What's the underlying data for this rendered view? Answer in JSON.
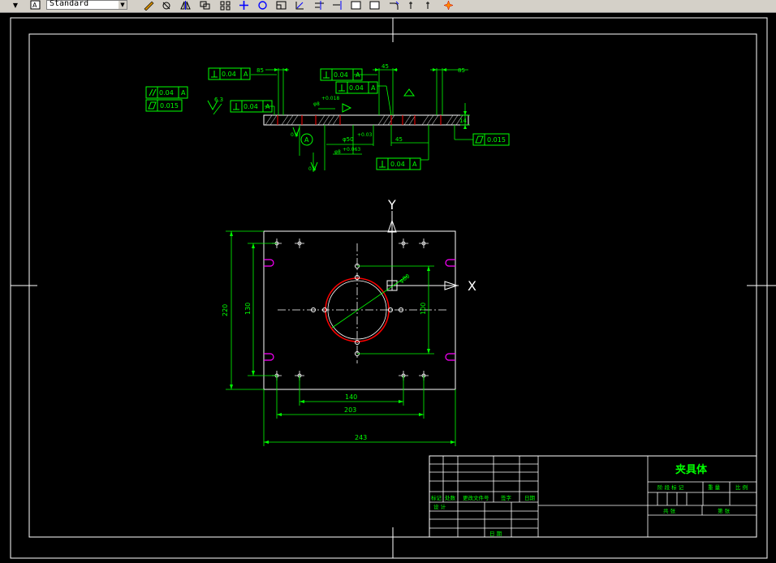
{
  "toolbar": {
    "text_style": "Standard",
    "icons": [
      "dropdown-arrow-icon",
      "text-style-icon",
      "pencil-icon",
      "erase-icon",
      "mirror-icon",
      "copy-icon",
      "array-icon",
      "move-icon",
      "rotate-icon",
      "scale-icon",
      "stretch-icon",
      "trim-icon",
      "extend-icon",
      "break-icon",
      "chamfer-icon",
      "fillet-icon",
      "explode-icon"
    ]
  },
  "drawing": {
    "section_view": {
      "perp_01": "0.04",
      "perp_01_datum": "A",
      "dim_top_1": "85",
      "perp_02": "0.04",
      "perp_02_datum": "A",
      "dim_top_2": "45",
      "dim_top_3": "85",
      "perp_03": "0.04",
      "perp_03_datum": "A",
      "parallel_tol": "0.04",
      "parallel_datum": "A",
      "flatness_tol_1": "0.015",
      "roughness_1": "6.3",
      "perp_04": "0.04",
      "perp_04_datum": "A",
      "dim_hole_1": "φ8",
      "dim_tol_1": "+0.018",
      "dim_thickness": "14",
      "flatness_tol_2": "0.015",
      "dim_left_1": "0.8",
      "datum_label": "A",
      "dim_center": "φ50",
      "dim_center_tol": "+0.03",
      "dim_bottom_1": "45",
      "dim_bottom_2": "φ8",
      "dim_bottom_tol": "+0.063",
      "roughness_2": "0.8",
      "perp_05": "0.04",
      "perp_05_datum": "A"
    },
    "plan_view": {
      "axis_y": "Y",
      "axis_x": "X",
      "dim_height_outer": "220",
      "dim_height_inner": "130",
      "dim_height_center": "100",
      "dim_diameter": "φ80",
      "dim_width_1": "140",
      "dim_width_2": "203",
      "dim_width_total": "243"
    },
    "title_block": {
      "part_name": "夹具体",
      "col_labels": [
        "标记",
        "处数",
        "更改文件号",
        "签字",
        "日期"
      ],
      "design_label": "设 计",
      "date_label": "日 期",
      "stage_label": "阶 段 标 记",
      "weight_label": "重 量",
      "scale_label": "比 例",
      "sheets_label": "共 张",
      "sheet_label": "第 张"
    }
  },
  "colors": {
    "background": "#000000",
    "geometry": "#ffffff",
    "dimension": "#00ff00",
    "circle": "#ff0000",
    "slot": "#ff00ff"
  }
}
